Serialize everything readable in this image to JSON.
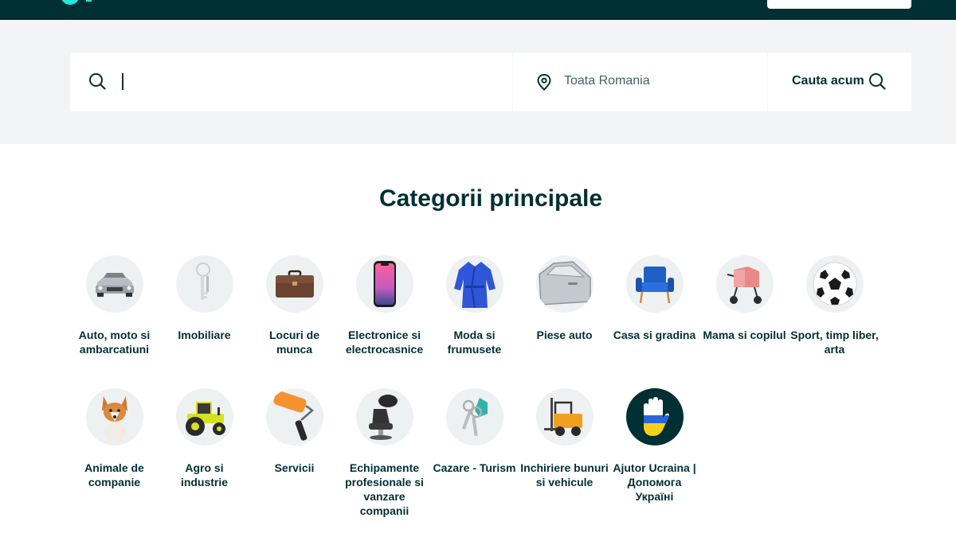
{
  "header": {
    "logo_icon": "olx-logo-icon",
    "account_button_label": ""
  },
  "search": {
    "query_value": "",
    "query_placeholder": "",
    "search_icon": "search-icon",
    "location_icon": "map-pin-icon",
    "location_value": "Toata Romania",
    "submit_label": "Cauta acum",
    "submit_icon": "search-icon"
  },
  "categories_section": {
    "title": "Categorii principale",
    "items": [
      {
        "label": "Auto, moto si ambarcatiuni",
        "icon": "car-icon"
      },
      {
        "label": "Imobiliare",
        "icon": "keys-icon"
      },
      {
        "label": "Locuri de munca",
        "icon": "briefcase-icon"
      },
      {
        "label": "Electronice si electrocasnice",
        "icon": "smartphone-icon"
      },
      {
        "label": "Moda si frumusete",
        "icon": "robe-icon"
      },
      {
        "label": "Piese auto",
        "icon": "car-door-icon"
      },
      {
        "label": "Casa si gradina",
        "icon": "armchair-icon"
      },
      {
        "label": "Mama si copilul",
        "icon": "stroller-icon"
      },
      {
        "label": "Sport, timp liber, arta",
        "icon": "soccer-ball-icon"
      },
      {
        "label": "Animale de companie",
        "icon": "dog-icon"
      },
      {
        "label": "Agro si industrie",
        "icon": "tractor-icon"
      },
      {
        "label": "Servicii",
        "icon": "paint-roller-icon"
      },
      {
        "label": "Echipamente profesionale si vanzare companii",
        "icon": "salon-chair-icon"
      },
      {
        "label": "Cazare - Turism",
        "icon": "room-keys-icon"
      },
      {
        "label": "Inchiriere bunuri si vehicule",
        "icon": "forklift-icon"
      },
      {
        "label": "Ajutor Ucraina | Допомога Україні",
        "icon": "ukraine-hand-icon"
      }
    ]
  },
  "colors": {
    "brand_dark": "#002f34",
    "brand_teal": "#23e5db",
    "band_bg": "#f2f4f5",
    "circle_bg": "#eef1f2"
  }
}
